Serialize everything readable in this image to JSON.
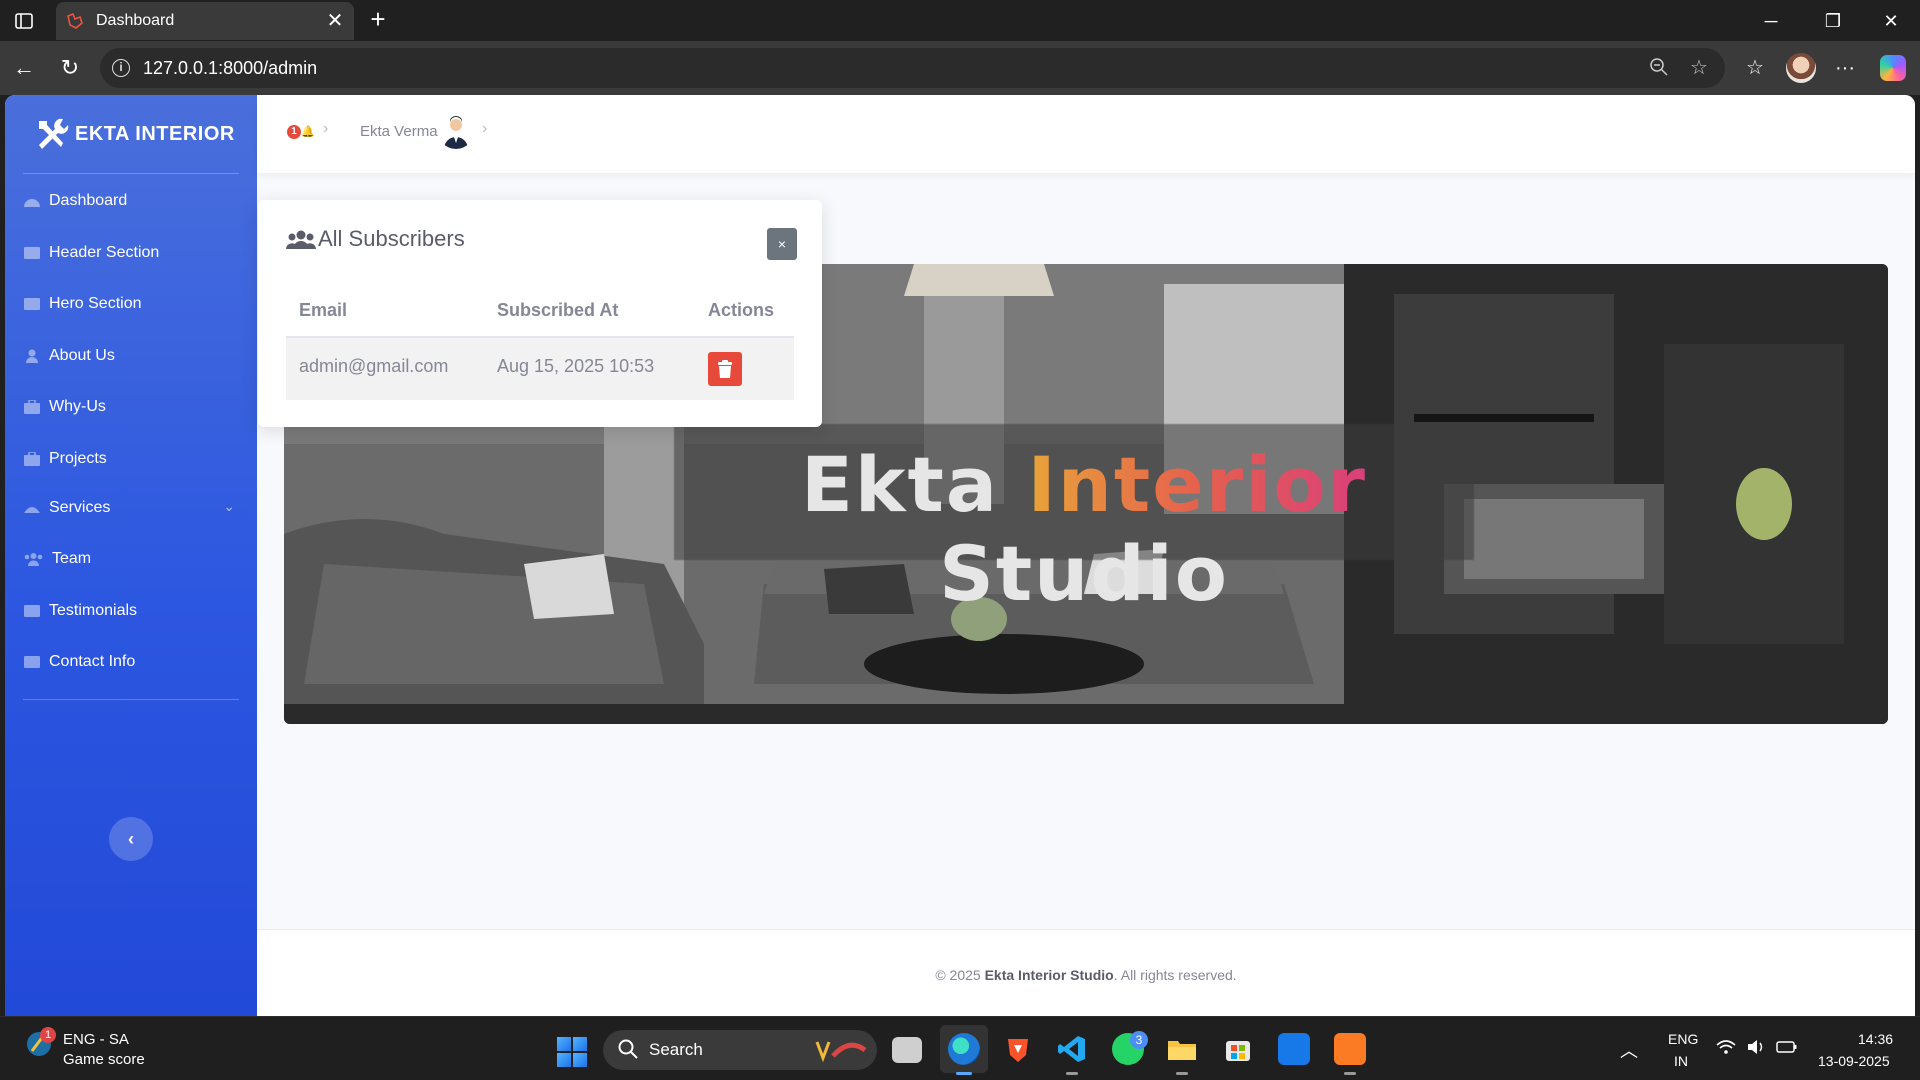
{
  "browser": {
    "tab_title": "Dashboard",
    "url": "127.0.0.1:8000/admin"
  },
  "sidebar": {
    "brand": "EKTA INTERIOR",
    "items": [
      {
        "label": "Dashboard",
        "icon": "dashboard-icon"
      },
      {
        "label": "Header Section",
        "icon": "header-icon"
      },
      {
        "label": "Hero Section",
        "icon": "hero-icon"
      },
      {
        "label": "About Us",
        "icon": "user-icon"
      },
      {
        "label": "Why-Us",
        "icon": "briefcase-icon"
      },
      {
        "label": "Projects",
        "icon": "projects-icon"
      },
      {
        "label": "Services",
        "icon": "services-icon",
        "expandable": true
      },
      {
        "label": "Team",
        "icon": "team-icon"
      },
      {
        "label": "Testimonials",
        "icon": "testimonials-icon"
      },
      {
        "label": "Contact Info",
        "icon": "contact-icon"
      }
    ]
  },
  "topbar": {
    "notification_count": "1",
    "user_name": "Ekta Verma"
  },
  "banner": {
    "title_part1": "Ekta",
    "title_accent": "Interior",
    "title_part2": "Studio"
  },
  "modal": {
    "title": "All Subscribers",
    "close_label": "×",
    "columns": [
      "Email",
      "Subscribed At",
      "Actions"
    ],
    "rows": [
      {
        "email": "admin@gmail.com",
        "subscribed_at": "Aug 15, 2025 10:53"
      }
    ]
  },
  "footer": {
    "copy": "© 2025",
    "brand": "Ekta Interior Studio",
    "rest": ". All rights reserved."
  },
  "taskbar": {
    "weather_line1": "ENG - SA",
    "weather_line2": "Game score",
    "weather_badge": "1",
    "search_label": "Search",
    "whatsapp_badge": "3",
    "lang1": "ENG",
    "lang2": "IN",
    "time": "14:36",
    "date": "13-09-2025"
  },
  "colors": {
    "sidebar": "#2c57e0",
    "danger": "#e74a3b",
    "secondary": "#6c757d"
  }
}
